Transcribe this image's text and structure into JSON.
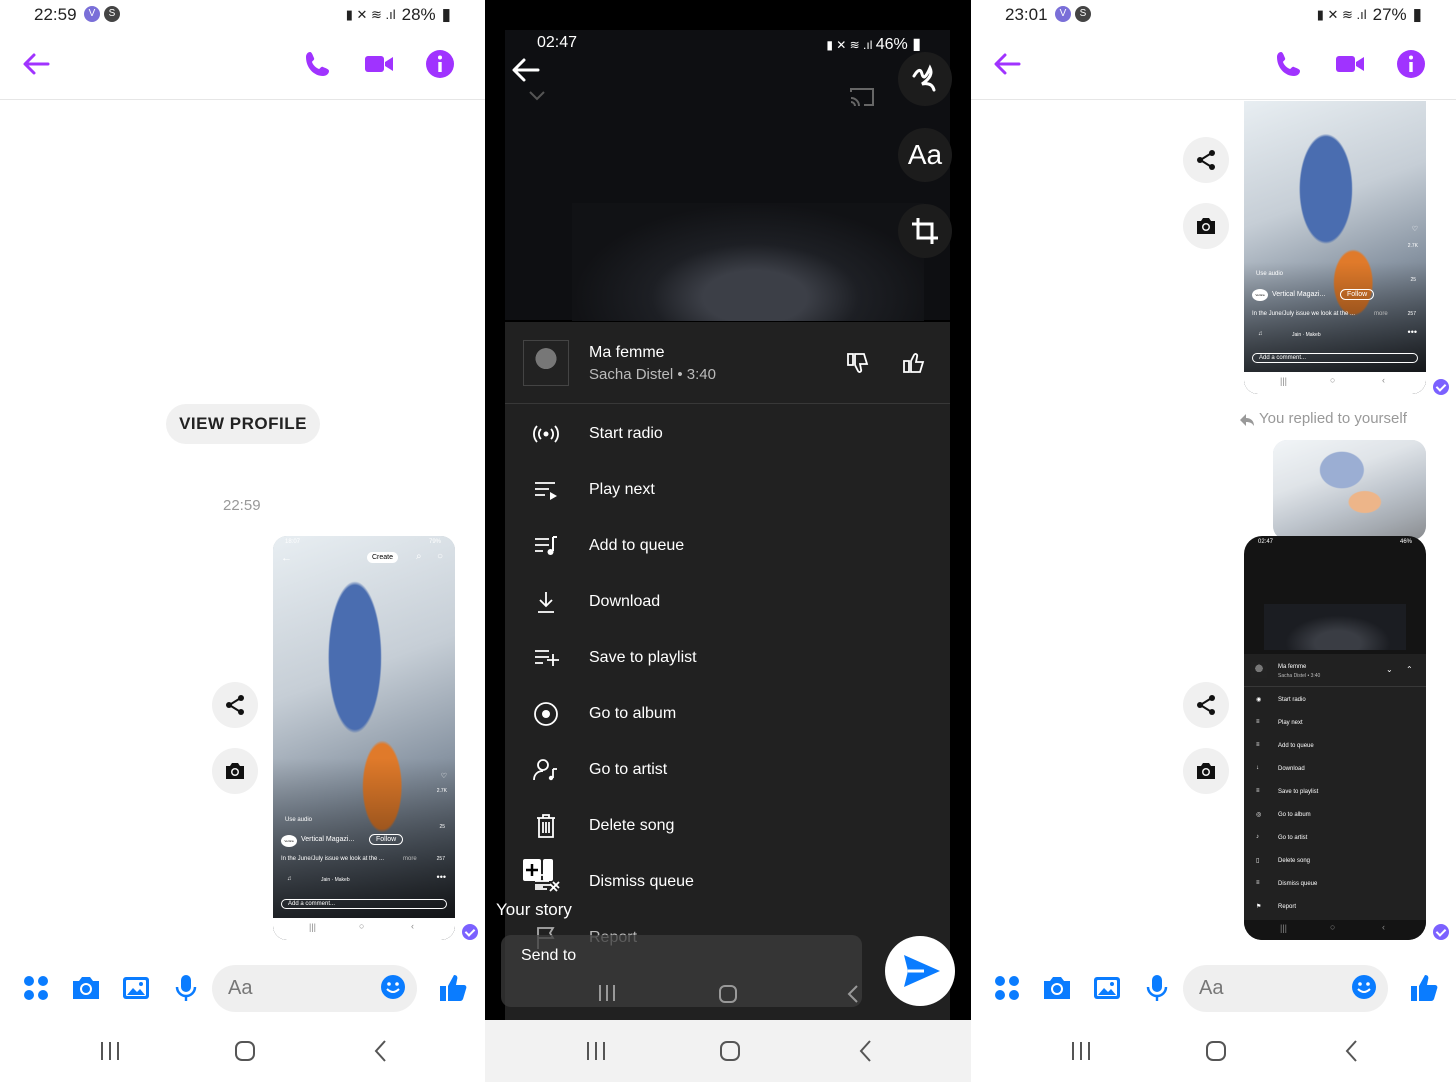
{
  "panel1": {
    "status": {
      "time": "22:59",
      "battery": "28%"
    },
    "view_profile": "VIEW PROFILE",
    "timestamp": "22:59",
    "preview": {
      "status_time": "18:07",
      "status_battery": "79%",
      "create_label": "Create",
      "use_audio": "Use audio",
      "account": "Vertical Magazi...",
      "account_badge": "Vertica",
      "follow": "Follow",
      "caption": "In the June/July issue we look at the ...",
      "more": "more",
      "likes": "2.7K",
      "comments": "25",
      "shares": "257",
      "audio_track": "Jain · Makeb",
      "comment_placeholder": "Add a comment..."
    },
    "compose_placeholder": "Aa"
  },
  "panel2": {
    "status": {
      "time": "02:47",
      "battery": "46%"
    },
    "text_tool": "Aa",
    "song": {
      "title": "Ma femme",
      "subtitle": "Sacha Distel • 3:40"
    },
    "menu": [
      {
        "label": "Start radio",
        "icon": "radio-icon"
      },
      {
        "label": "Play next",
        "icon": "play-next-icon"
      },
      {
        "label": "Add to queue",
        "icon": "queue-icon"
      },
      {
        "label": "Download",
        "icon": "download-icon"
      },
      {
        "label": "Save to playlist",
        "icon": "playlist-add-icon"
      },
      {
        "label": "Go to album",
        "icon": "album-icon"
      },
      {
        "label": "Go to artist",
        "icon": "artist-icon"
      },
      {
        "label": "Delete song",
        "icon": "trash-icon"
      },
      {
        "label": "Dismiss queue",
        "icon": "dismiss-queue-icon"
      },
      {
        "label": "Report",
        "icon": "flag-icon"
      }
    ],
    "your_story": "Your story",
    "send_to": "Send to"
  },
  "panel3": {
    "status": {
      "time": "23:01",
      "battery": "27%"
    },
    "reply_note": "You replied to yourself",
    "preview": {
      "use_audio": "Use audio",
      "account": "Vertical Magazi...",
      "account_badge": "Vertica",
      "follow": "Follow",
      "caption": "In the June/July issue we look at the ...",
      "more": "more",
      "likes": "2.7K",
      "comments": "25",
      "shares": "257",
      "audio_track": "Jain · Makeb",
      "comment_placeholder": "Add a comment..."
    },
    "mini_status_time": "02:47",
    "mini_status_battery": "46%",
    "mini_song_title": "Ma femme",
    "mini_song_sub": "Sacha Distel • 3:40",
    "mini_menu": [
      "Start radio",
      "Play next",
      "Add to queue",
      "Download",
      "Save to playlist",
      "Go to album",
      "Go to artist",
      "Delete song",
      "Dismiss queue",
      "Report"
    ],
    "compose_placeholder": "Aa"
  },
  "colors": {
    "messenger_purple": "#a033ff",
    "messenger_blue": "#0a7cff",
    "read_check": "#7b61ff"
  }
}
